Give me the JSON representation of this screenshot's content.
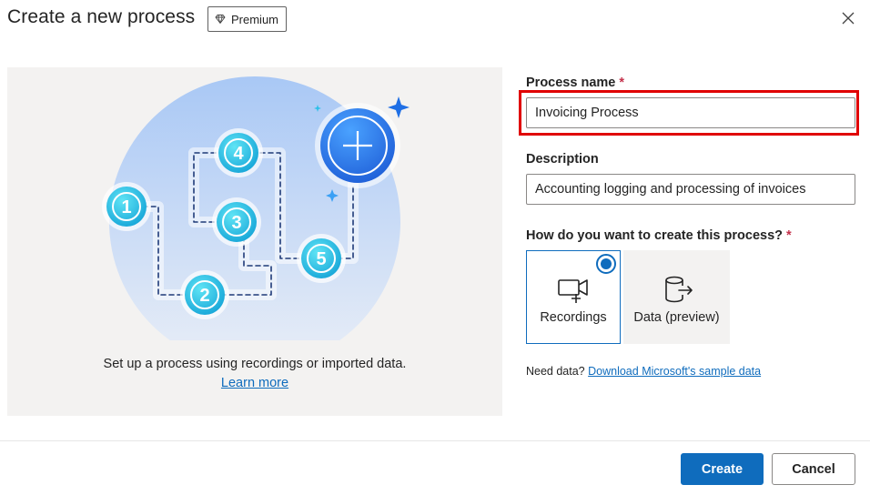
{
  "dialog": {
    "title": "Create a new process",
    "badge": "Premium",
    "close_icon": "close-icon"
  },
  "illustration": {
    "steps": [
      "1",
      "2",
      "3",
      "4",
      "5"
    ],
    "caption": "Set up a process using recordings or imported data.",
    "learn_more": "Learn more"
  },
  "form": {
    "process_name_label": "Process name",
    "required_mark": "*",
    "process_name_value": "Invoicing Process",
    "description_label": "Description",
    "description_value": "Accounting logging and processing of invoices",
    "create_method_label": "How do you want to create this process?",
    "options": [
      {
        "label": "Recordings",
        "icon": "video-camera-icon",
        "selected": true
      },
      {
        "label": "Data (preview)",
        "icon": "database-export-icon",
        "selected": false
      }
    ],
    "need_data_text": "Need data?",
    "sample_data_link": "Download Microsoft's sample data"
  },
  "footer": {
    "create_label": "Create",
    "cancel_label": "Cancel"
  },
  "colors": {
    "accent": "#0f6cbd",
    "highlight": "#e00000",
    "panel": "#f3f2f1"
  }
}
